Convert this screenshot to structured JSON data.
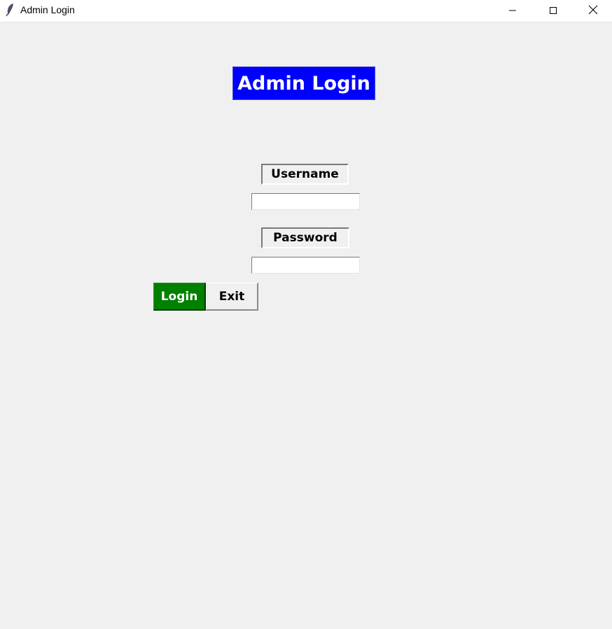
{
  "window": {
    "title": "Admin Login",
    "app_icon": "feather-icon",
    "controls": {
      "minimize_icon": "minimize-icon",
      "maximize_icon": "maximize-icon",
      "close_icon": "close-icon"
    }
  },
  "form": {
    "header": "Admin Login",
    "username_label": "Username",
    "username_value": "",
    "password_label": "Password",
    "password_value": "",
    "login_button": "Login",
    "exit_button": "Exit"
  },
  "colors": {
    "header_bg": "#0000ff",
    "header_fg": "#ffffff",
    "login_bg": "#008000",
    "login_fg": "#ffffff",
    "window_bg": "#f0f0f0"
  }
}
